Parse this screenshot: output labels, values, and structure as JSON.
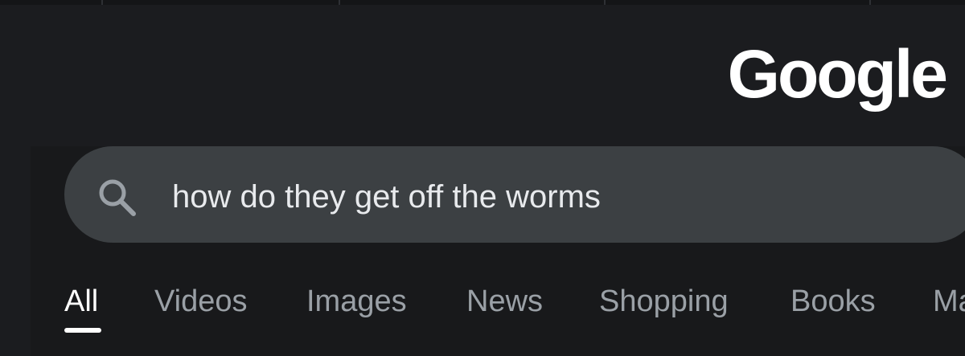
{
  "app": {
    "logo_text": "Google"
  },
  "search": {
    "query": "how do they get off the worms",
    "icon": "search-icon"
  },
  "tabs": [
    {
      "label": "All",
      "active": true
    },
    {
      "label": "Videos",
      "active": false
    },
    {
      "label": "Images",
      "active": false
    },
    {
      "label": "News",
      "active": false
    },
    {
      "label": "Shopping",
      "active": false
    },
    {
      "label": "Books",
      "active": false
    },
    {
      "label": "Ma",
      "active": false
    }
  ],
  "colors": {
    "background": "#1b1c1f",
    "search_box": "#3c4043",
    "text_primary": "#e8eaed",
    "text_secondary": "#9aa0a6"
  }
}
